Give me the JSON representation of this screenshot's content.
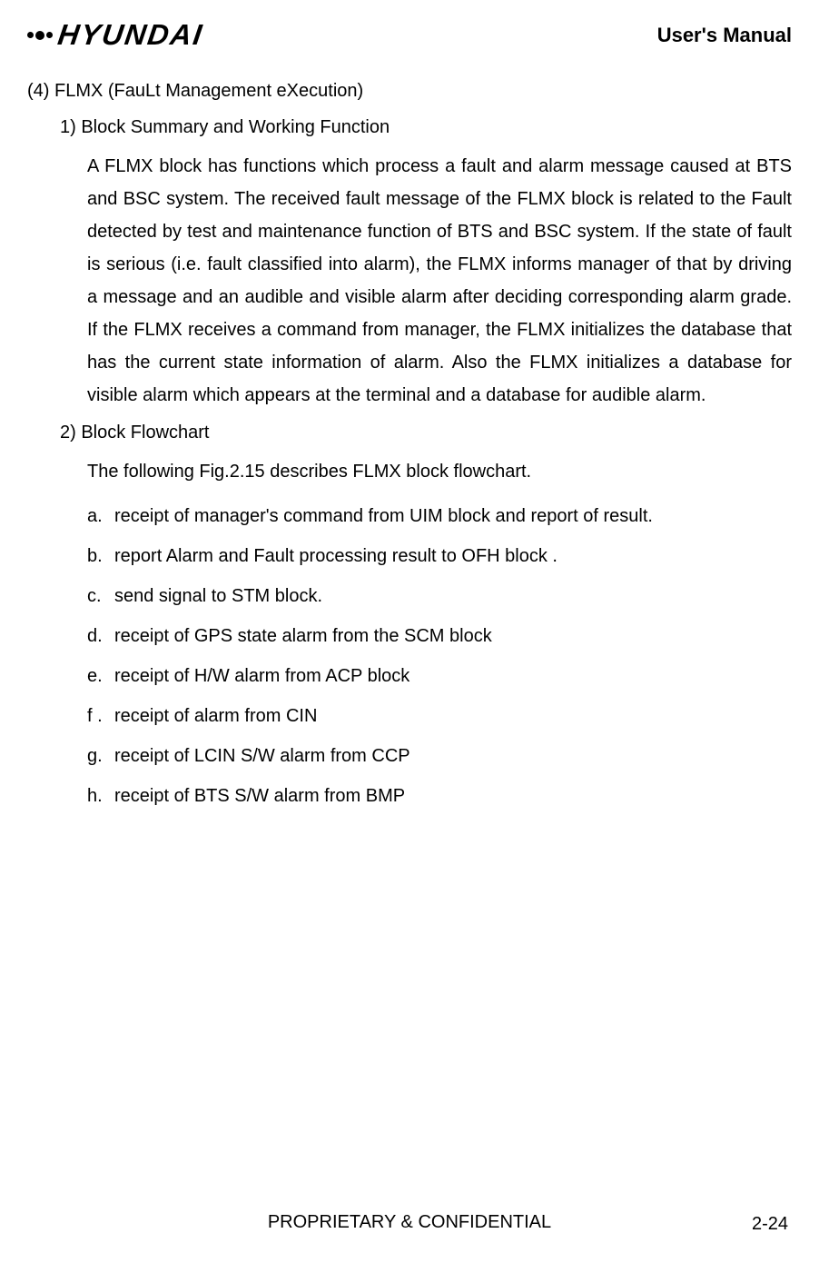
{
  "header": {
    "logo_text": "HYUNDAI",
    "manual_title": "User's Manual"
  },
  "section": {
    "title": "(4) FLMX (FauLt Management eXecution)",
    "sub1_title": "1) Block Summary and Working Function",
    "sub1_para": "A FLMX block has functions which process a fault and alarm message caused at BTS and BSC system. The received fault message of the FLMX block is related to the Fault detected by test and maintenance function of BTS and BSC system. If the state of fault is serious (i.e. fault classified into alarm), the FLMX informs manager of that by driving a message and an audible and visible alarm after deciding corresponding alarm grade. If the FLMX receives a command from manager, the FLMX  initializes the database that has the current state information of alarm. Also the FLMX initializes a database for visible alarm which appears at the terminal and a database for audible alarm.",
    "sub2_title": "2) Block Flowchart",
    "sub2_intro": "The following Fig.2.15 describes FLMX block flowchart.",
    "items": [
      {
        "marker": "a.",
        "text": "receipt of manager's command from UIM block and report of result."
      },
      {
        "marker": "b.",
        "text": "report Alarm and Fault processing result to OFH block ."
      },
      {
        "marker": "c.",
        "text": "send signal to STM block."
      },
      {
        "marker": "d.",
        "text": "receipt of GPS state alarm from the SCM block"
      },
      {
        "marker": "e.",
        "text": "receipt of H/W alarm from ACP block"
      },
      {
        "marker": "f .",
        "text": "receipt of alarm from CIN"
      },
      {
        "marker": "g.",
        "text": "receipt of LCIN S/W alarm from CCP"
      },
      {
        "marker": "h.",
        "text": "receipt of BTS S/W alarm from BMP"
      }
    ]
  },
  "footer": {
    "confidential": "PROPRIETARY & CONFIDENTIAL",
    "page": "2-24"
  }
}
